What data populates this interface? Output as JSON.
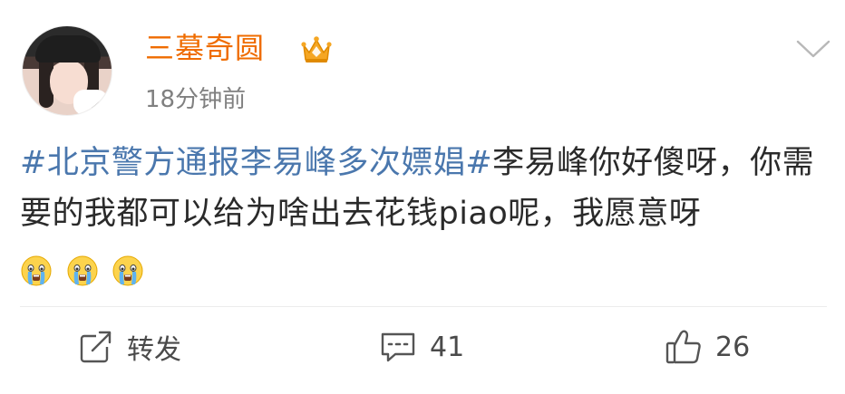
{
  "post": {
    "username": "三墓奇圆",
    "timestamp": "18分钟前",
    "hashtag": "#北京警方通报李易峰多次嫖娼#",
    "text": "李易峰你好傻呀，你需要的我都可以给为啥出去花钱piao呢，我愿意呀",
    "emojis": [
      "crying-face-emoji",
      "crying-face-emoji",
      "crying-face-emoji"
    ]
  },
  "actions": {
    "repost_label": "转发",
    "comment_count": "41",
    "like_count": "26"
  },
  "icons": {
    "verified_badge": "crown-icon",
    "menu": "chevron-down-icon",
    "repost": "share-icon",
    "comment": "comment-icon",
    "like": "thumbs-up-icon"
  },
  "colors": {
    "username": "#ef6c00",
    "hashtag": "#4a77ad",
    "timestamp": "#808080",
    "text": "#2a2a2a",
    "divider": "#ececec"
  }
}
